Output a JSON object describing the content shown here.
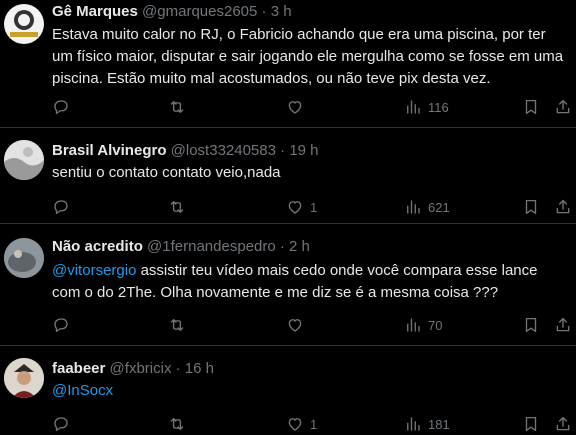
{
  "tweets": [
    {
      "name": "Gê Marques",
      "handle": "@gmarques2605",
      "sep": "·",
      "time": "3 h",
      "text": "Estava muito calor no RJ, o Fabricio achando que era uma piscina, por ter um físico maior, disputar e sair jogando ele mergulha como se fosse em uma piscina. Estão muito mal acostumados, ou não teve pix desta vez.",
      "likes": "",
      "views": "116"
    },
    {
      "name": "Brasil Alvinegro",
      "handle": "@lost33240583",
      "sep": "·",
      "time": "19 h",
      "text": "sentiu o contato contato veio,nada",
      "likes": "1",
      "views": "621"
    },
    {
      "name": "Não acredito",
      "handle": "@1fernandespedro",
      "sep": "·",
      "time": "2 h",
      "mention": "@vitorsergio",
      "text": " assistir teu vídeo mais cedo onde você compara esse lance com o do 2The. Olha novamente e me diz se é a mesma coisa ???",
      "likes": "",
      "views": "70"
    },
    {
      "name": "faabeer",
      "handle": "@fxbricix",
      "sep": "·",
      "time": "16 h",
      "mention": "@InSocx",
      "text": "",
      "likes": "1",
      "views": "181"
    }
  ],
  "icons": [
    "reply-icon",
    "retweet-icon",
    "like-icon",
    "views-icon",
    "bookmark-icon",
    "share-icon"
  ],
  "colors": {
    "background": "#000000",
    "text": "#e7e9ea",
    "muted": "#71767b",
    "link": "#1d9bf0",
    "divider": "#2f3336"
  }
}
